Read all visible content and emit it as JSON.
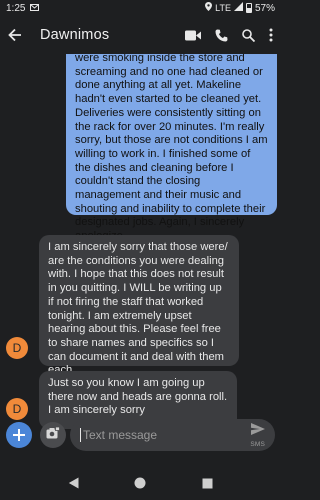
{
  "status_bar": {
    "time": "1:25",
    "network": "LTE",
    "battery": "57%"
  },
  "app_bar": {
    "title": "Dawnimos",
    "icons": [
      "back-arrow-icon",
      "video-call-icon",
      "phone-icon",
      "search-icon",
      "more-vert-icon"
    ]
  },
  "messages": [
    {
      "direction": "outgoing",
      "text": "were smoking inside the store and screaming and no one had cleaned or done anything at all yet. Makeline hadn't even started to be cleaned yet. Deliveries were consistently sitting on the rack for over 20 minutes. I'm really sorry, but those are not conditions I am willing to work in. I finished some of the dishes and cleaning before I couldn't stand the closing management and their music and shouting and inability to complete their designated jobs. Again, I sincerely apologize."
    },
    {
      "direction": "incoming",
      "avatar": "D",
      "text": "I am sincerely sorry that those were/ are the conditions you were dealing with. I hope that this does not result in you quitting. I WILL be writing up if not firing the staff that worked tonight. I am extremely upset hearing about this. Please feel free to share names and specifics so I can document it and deal with them each."
    },
    {
      "direction": "incoming",
      "avatar": "D",
      "text": "Just so you know I am going up there now and heads are gonna roll. I am sincerely sorry"
    }
  ],
  "compose": {
    "placeholder": "Text message",
    "send_label": "SMS"
  },
  "colors": {
    "background": "#1e1f21",
    "outgoing_bubble": "#7fa8e8",
    "incoming_bubble": "#3c3d40",
    "avatar": "#f08a3a",
    "fab": "#4b86d8"
  }
}
